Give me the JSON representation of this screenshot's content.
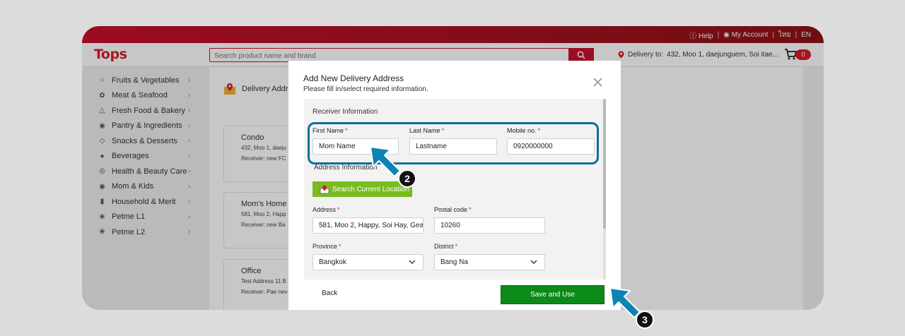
{
  "topbar": {
    "help": "Help",
    "sep1": "|",
    "account": "My Account",
    "sep2": "|",
    "lang_th": "ไทย",
    "sep3": "|",
    "lang_en": "EN"
  },
  "header": {
    "logo": "Tops",
    "search_placeholder": "Search product name and brand",
    "delivery_label": "Delivery to:",
    "delivery_address": "432, Moo 1, daejunguem, Soi itae...",
    "cart_count": "0"
  },
  "sidebar": {
    "items": [
      {
        "label": "Fruits & Vegetables",
        "icon": "apple-icon"
      },
      {
        "label": "Meat & Seafood",
        "icon": "fish-icon"
      },
      {
        "label": "Fresh Food & Bakery",
        "icon": "bread-icon"
      },
      {
        "label": "Pantry & Ingredients",
        "icon": "pantry-icon"
      },
      {
        "label": "Snacks & Desserts",
        "icon": "snack-icon"
      },
      {
        "label": "Beverages",
        "icon": "bottle-icon"
      },
      {
        "label": "Health & Beauty Care",
        "icon": "health-icon"
      },
      {
        "label": "Mom & Kids",
        "icon": "baby-icon"
      },
      {
        "label": "Household & Merit",
        "icon": "household-icon"
      },
      {
        "label": "Petme L1",
        "icon": "pet-icon"
      },
      {
        "label": "Petme L2",
        "icon": "pet-icon"
      }
    ]
  },
  "content": {
    "title": "Delivery Addre",
    "cards": [
      {
        "name": "Condo",
        "address": "432, Moo 1, daeju",
        "receiver": "Receiver: new FC"
      },
      {
        "name": "Mom's Home",
        "address": "581, Moo 2, Happ",
        "receiver": "Receiver: new Ba"
      },
      {
        "name": "Office",
        "address": "Test Address 11 B",
        "receiver": "Receiver: Pae nev"
      }
    ]
  },
  "modal": {
    "title": "Add New Delivery Address",
    "subtitle": "Please fill in/select required information.",
    "receiver_section": "Receiver Information",
    "first_name_label": "First Name",
    "first_name_value": "Mom Name",
    "last_name_label": "Last Name",
    "last_name_value": "Lastname",
    "mobile_label": "Mobile no.",
    "mobile_value": "0920000000",
    "address_section": "Address Information",
    "locate_button": "Search Current Location",
    "address_label": "Address",
    "address_value": "581, Moo 2, Happy, Soi Hay, Gea",
    "postal_label": "Postal code",
    "postal_value": "10260",
    "province_label": "Province",
    "province_value": "Bangkok",
    "district_label": "District",
    "district_value": "Bang Na",
    "required_mark": "*",
    "back_button": "Back",
    "save_button": "Save and Use"
  },
  "callouts": {
    "step2": "2",
    "step3": "3"
  },
  "colors": {
    "brand_red": "#c8102e",
    "save_green": "#0b8a1a",
    "location_green": "#79bc1f",
    "highlight_blue": "#0d6f97"
  }
}
